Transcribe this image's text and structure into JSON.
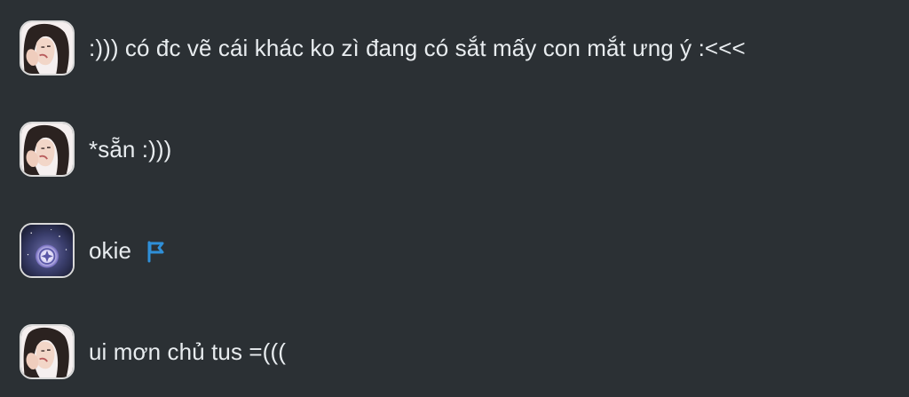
{
  "messages": [
    {
      "avatar": "girl-photo-avatar",
      "text": ":))) có đc vẽ cái khác ko zì đang có sắt mấy con mắt ưng ý :<<<",
      "flag": false
    },
    {
      "avatar": "girl-photo-avatar",
      "text": "*sẵn :)))",
      "flag": false
    },
    {
      "avatar": "space-badge-avatar",
      "text": "okie",
      "flag": true,
      "flag_icon": "flag-icon",
      "flag_color": "#2f8fd8"
    },
    {
      "avatar": "girl-photo-avatar",
      "text": "ui mơn chủ tus =(((",
      "flag": false
    }
  ],
  "colors": {
    "background": "#2b3034",
    "text": "#e8ecef",
    "avatar_border": "#d9d9d9"
  }
}
